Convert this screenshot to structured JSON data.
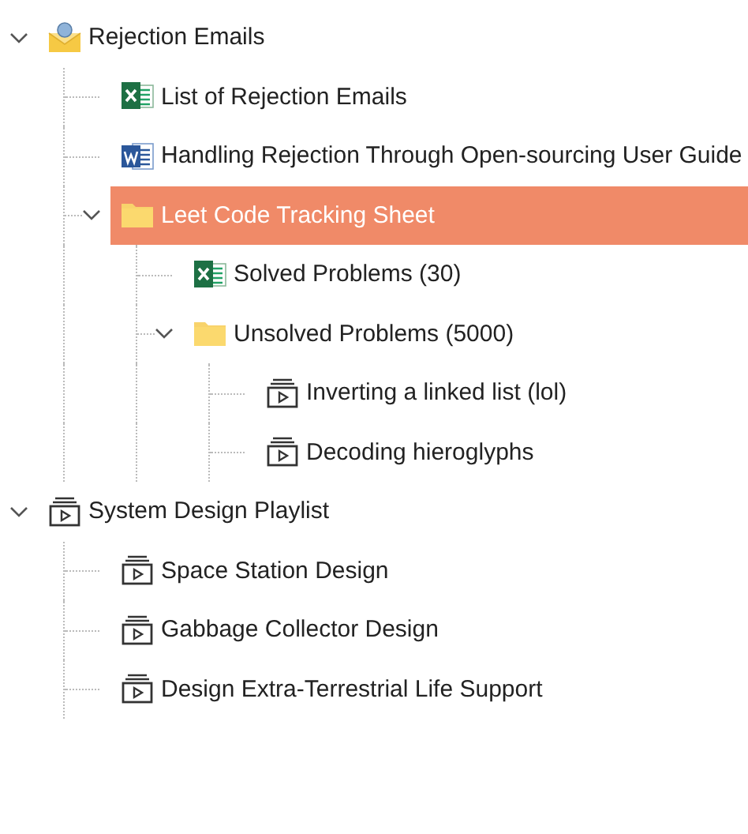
{
  "tree": [
    {
      "kind": "email",
      "label": "Rejection Emails",
      "expanded": true,
      "selected": false,
      "children": [
        {
          "kind": "excel",
          "label": "List of Rejection Emails",
          "selected": false
        },
        {
          "kind": "word",
          "label": "Handling Rejection Through Open-sourcing User Guide",
          "selected": false
        },
        {
          "kind": "folder",
          "label": "Leet Code Tracking Sheet",
          "expanded": true,
          "selected": true,
          "children": [
            {
              "kind": "excel",
              "label": "Solved Problems (30)",
              "selected": false
            },
            {
              "kind": "folder",
              "label": "Unsolved Problems (5000)",
              "expanded": true,
              "selected": false,
              "children": [
                {
                  "kind": "playlist",
                  "label": "Inverting a linked list (lol)",
                  "selected": false
                },
                {
                  "kind": "playlist",
                  "label": "Decoding hieroglyphs",
                  "selected": false
                }
              ]
            }
          ]
        }
      ]
    },
    {
      "kind": "playlist",
      "label": "System Design Playlist",
      "expanded": true,
      "selected": false,
      "children": [
        {
          "kind": "playlist",
          "label": "Space Station Design",
          "selected": false
        },
        {
          "kind": "playlist",
          "label": "Gabbage Collector Design",
          "selected": false
        },
        {
          "kind": "playlist",
          "label": "Design Extra-Terrestrial Life Support",
          "selected": false
        }
      ]
    }
  ]
}
